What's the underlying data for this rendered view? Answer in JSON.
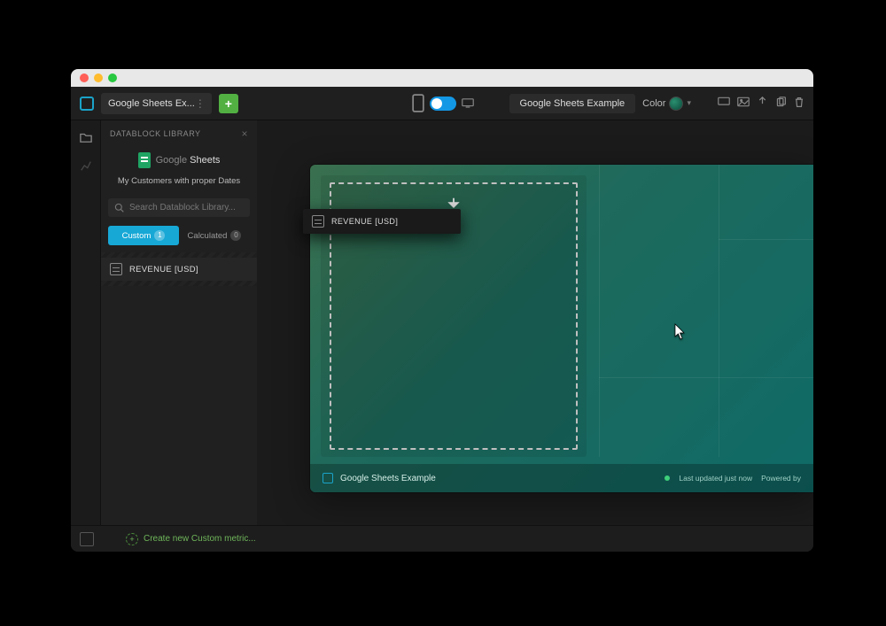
{
  "toolbar": {
    "tab_title": "Google Sheets Ex...",
    "add_label": "+",
    "center_title": "Google Sheets Example",
    "color_label": "Color"
  },
  "sidebar": {
    "panel_title": "DATABLOCK LIBRARY",
    "source_name": "Google Sheets",
    "source_sub": "My Customers with proper Dates",
    "search_placeholder": "Search Datablock Library...",
    "tabs": {
      "custom_label": "Custom",
      "custom_count": "1",
      "calculated_label": "Calculated",
      "calculated_count": "0"
    },
    "metrics": [
      {
        "label": "REVENUE [USD]"
      }
    ]
  },
  "drag": {
    "label": "REVENUE [USD]"
  },
  "dashboard": {
    "title": "Google Sheets Example",
    "last_updated": "Last updated just now",
    "powered": "Powered by"
  },
  "bottombar": {
    "create_label": "Create new Custom metric..."
  },
  "icons": {
    "close": "×",
    "chevron_down": "▾"
  }
}
